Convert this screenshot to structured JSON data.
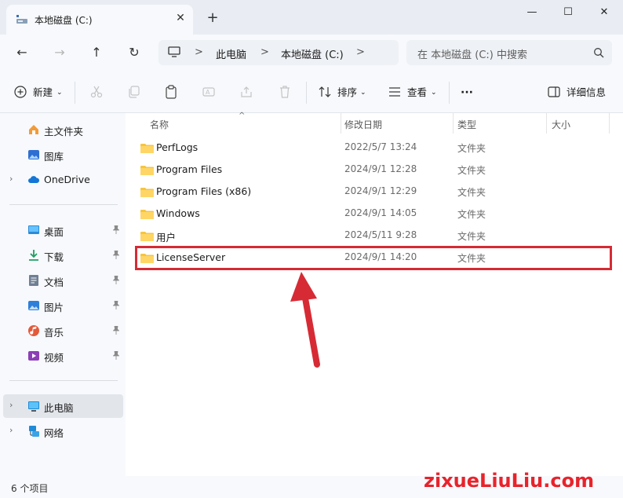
{
  "window": {
    "tab_title": "本地磁盘 (C:)",
    "close_tab": "✕",
    "new_tab": "+",
    "minimize": "—",
    "maximize": "☐",
    "close": "✕"
  },
  "nav": {
    "back": "←",
    "forward": "→",
    "up": "↑",
    "refresh": "↻"
  },
  "breadcrumb": {
    "items": [
      "此电脑",
      "本地磁盘 (C:)"
    ],
    "separator": ">"
  },
  "search": {
    "placeholder": "在 本地磁盘 (C:) 中搜索"
  },
  "toolbar": {
    "new_label": "新建",
    "sort_label": "排序",
    "view_label": "查看",
    "more_label": "···",
    "details_label": "详细信息"
  },
  "sidebar": {
    "home": "主文件夹",
    "gallery": "图库",
    "onedrive": "OneDrive",
    "desktop": "桌面",
    "downloads": "下载",
    "documents": "文档",
    "pictures": "图片",
    "music": "音乐",
    "videos": "视频",
    "this_pc": "此电脑",
    "network": "网络"
  },
  "columns": {
    "name": "名称",
    "modified": "修改日期",
    "type": "类型",
    "size": "大小"
  },
  "files": [
    {
      "name": "PerfLogs",
      "date": "2022/5/7 13:24",
      "type": "文件夹"
    },
    {
      "name": "Program Files",
      "date": "2024/9/1 12:28",
      "type": "文件夹"
    },
    {
      "name": "Program Files (x86)",
      "date": "2024/9/1 12:29",
      "type": "文件夹"
    },
    {
      "name": "Windows",
      "date": "2024/9/1 14:05",
      "type": "文件夹"
    },
    {
      "name": "用户",
      "date": "2024/5/11 9:28",
      "type": "文件夹"
    },
    {
      "name": "LicenseServer",
      "date": "2024/9/1 14:20",
      "type": "文件夹"
    }
  ],
  "status": {
    "item_count": "6 个项目"
  },
  "watermark": "zixueLiuLiu.com",
  "colors": {
    "highlight": "#d62b35",
    "folder": "#f5c542",
    "accent": "#0067c0"
  }
}
